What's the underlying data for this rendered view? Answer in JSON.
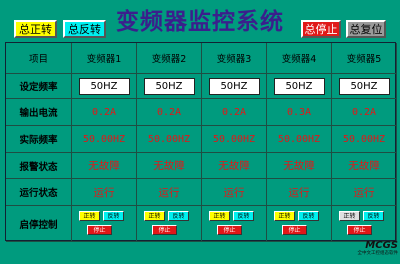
{
  "title": "变频器监控系统",
  "buttons": {
    "all_forward": "总正转",
    "all_reverse": "总反转",
    "all_stop": "总停止",
    "all_reset": "总复位"
  },
  "table": {
    "headers": [
      "项目",
      "变频器1",
      "变频器2",
      "变频器3",
      "变频器4",
      "变频器5"
    ],
    "row_labels": {
      "set_freq": "设定频率",
      "current": "输出电流",
      "actual_freq": "实际频率",
      "alarm": "报警状态",
      "run": "运行状态",
      "control": "启停控制"
    },
    "set_freq": [
      "50HZ",
      "50HZ",
      "50HZ",
      "50HZ",
      "50HZ"
    ],
    "current": [
      "0.2A",
      "0.2A",
      "0.2A",
      "0.3A",
      "0.2A"
    ],
    "actual_freq": [
      "50.00HZ",
      "50.00HZ",
      "50.00HZ",
      "50.00HZ",
      "50.00HZ"
    ],
    "alarm": [
      "无故障",
      "无故障",
      "无故障",
      "无故障",
      "无故障"
    ],
    "run": [
      "运行",
      "运行",
      "运行",
      "运行",
      "运行"
    ],
    "control": {
      "forward": "正转",
      "reverse": "反转",
      "stop": "停止",
      "forward_colors": [
        "#ffff00",
        "#ffff00",
        "#ffff00",
        "#ffff00",
        "#e0e0e0"
      ]
    }
  },
  "logo": {
    "text": "MCGS",
    "subtitle": "全中文工控组态软件"
  },
  "colors": {
    "background": "#009b7e",
    "title": "#3a1f8c",
    "value_red": "#e01818",
    "forward_yellow": "#ffff00",
    "reverse_cyan": "#00f0f0",
    "stop_red": "#e01818",
    "reset_gray": "#9a9a9a"
  }
}
